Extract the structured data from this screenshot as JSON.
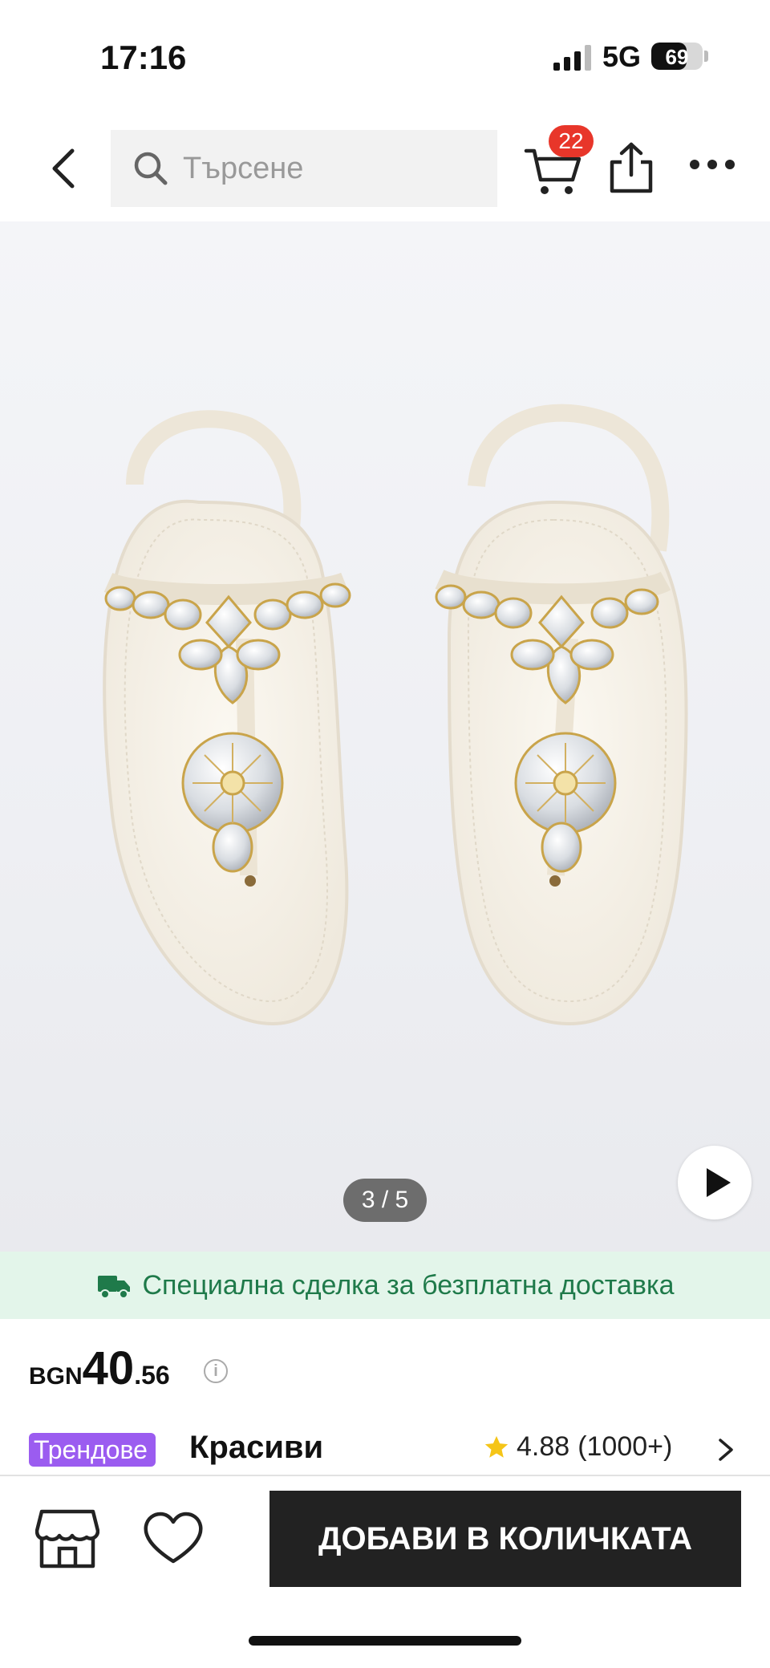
{
  "status_bar": {
    "time": "17:16",
    "network": "5G",
    "battery": "69"
  },
  "nav": {
    "search_placeholder": "Търсене",
    "cart_badge": "22"
  },
  "gallery": {
    "counter": "3 / 5"
  },
  "shipping_banner": {
    "text": "Специална сделка за безплатна доставка"
  },
  "price": {
    "currency": "BGN",
    "integer": "40",
    "decimal": ".56",
    "info": "i"
  },
  "product": {
    "trend_badge": "Трендове",
    "name": "Красиви",
    "rating": "4.88",
    "review_count": "(1000+)"
  },
  "bottom_bar": {
    "add_to_cart": "ДОБАВИ В КОЛИЧКАТА"
  },
  "colors": {
    "accent": "#222222",
    "badge": "#e8362a",
    "shipping_bg": "#e3f5ea",
    "shipping_text": "#1f7a4a",
    "trend": "#9b5cf0",
    "star": "#f5c518"
  },
  "icons": [
    "back-icon",
    "search-icon",
    "cart-icon",
    "share-icon",
    "more-icon",
    "truck-icon",
    "info-icon",
    "star-icon",
    "chevron-right-icon",
    "store-icon",
    "heart-icon",
    "play-icon"
  ]
}
